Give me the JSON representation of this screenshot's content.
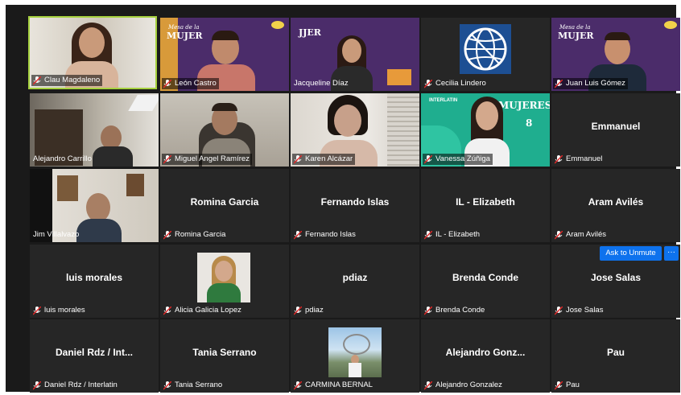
{
  "participants": [
    {
      "label": "Clau Magdaleno"
    },
    {
      "label": "León Castro",
      "banner": {
        "small": "Mesa de la",
        "big": "MUJER"
      }
    },
    {
      "label": "Jacqueline Díaz",
      "banner": {
        "small": "",
        "big": "JJER"
      }
    },
    {
      "label": "Cecilia Lindero"
    },
    {
      "label": "Juan Luis Gómez",
      "banner": {
        "small": "Mesa de la",
        "big": "MUJER"
      }
    },
    {
      "label": "Alejandro Carrillo"
    },
    {
      "label": "Miguel Angel Ramírez"
    },
    {
      "label": "Karen Alcázar"
    },
    {
      "label": "Vanessa Zúñiga",
      "banner": {
        "small": "INTERLATIN",
        "big": "MUJERES",
        "num": "8"
      }
    },
    {
      "label": "Emmanuel",
      "display": "Emmanuel"
    },
    {
      "label": "Jim Villalvazo"
    },
    {
      "label": "Romina Garcia",
      "display": "Romina Garcia"
    },
    {
      "label": "Fernando Islas",
      "display": "Fernando Islas"
    },
    {
      "label": "IL - Elizabeth",
      "display": "IL - Elizabeth"
    },
    {
      "label": "Aram Avilés",
      "display": "Aram Avilés"
    },
    {
      "label": "luis morales",
      "display": "luis morales"
    },
    {
      "label": "Alicia Galicia Lopez"
    },
    {
      "label": "pdiaz",
      "display": "pdiaz"
    },
    {
      "label": "Brenda Conde",
      "display": "Brenda Conde"
    },
    {
      "label": "Jose Salas",
      "display": "Jose Salas"
    },
    {
      "label": "Daniel Rdz / Interlatin",
      "display": "Daniel Rdz / Int..."
    },
    {
      "label": "Tania Serrano",
      "display": "Tania Serrano"
    },
    {
      "label": "CARMINA BERNAL"
    },
    {
      "label": "Alejandro Gonzalez",
      "display": "Alejandro  Gonz..."
    },
    {
      "label": "Pau",
      "display": "Pau"
    }
  ],
  "controls": {
    "ask_to_unmute": "Ask to Unmute",
    "more": "···"
  },
  "colors": {
    "active_speaker": "#a6d13f",
    "unmute_button": "#0e72ed",
    "muted_mic": "#e02828",
    "tile_bg": "#262626",
    "gallery_bg": "#1a1a1a"
  }
}
